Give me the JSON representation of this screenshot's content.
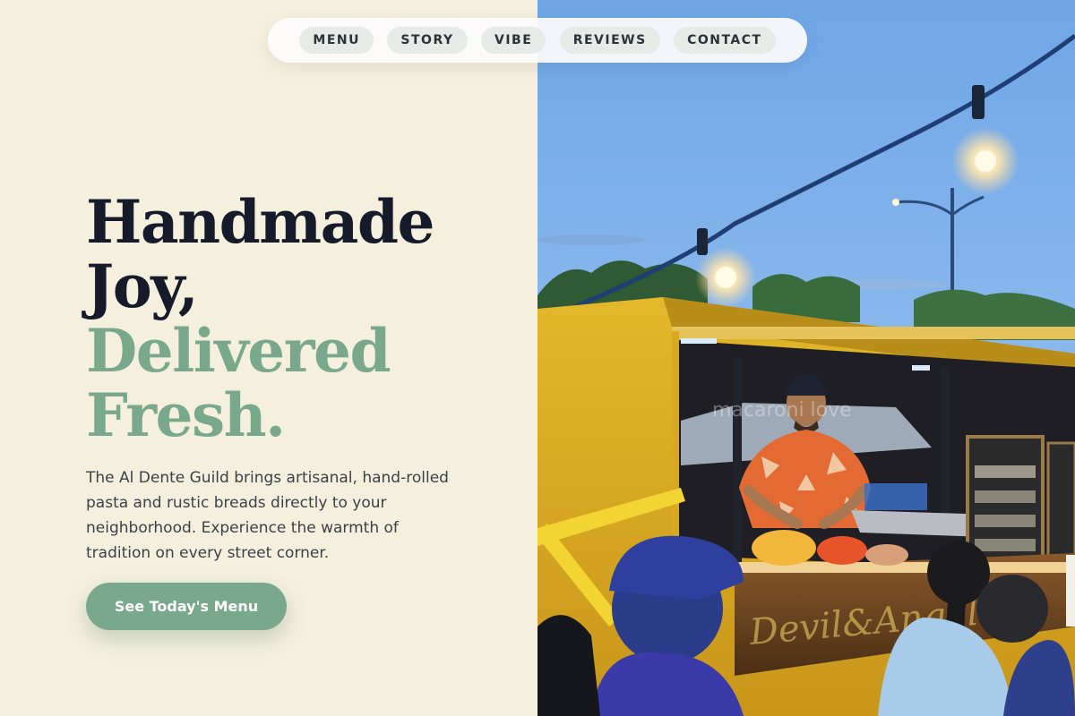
{
  "nav": {
    "items": [
      {
        "label": "MENU"
      },
      {
        "label": "STORY"
      },
      {
        "label": "VIBE"
      },
      {
        "label": "REVIEWS"
      },
      {
        "label": "CONTACT"
      }
    ]
  },
  "hero": {
    "headline_line1": "Handmade",
    "headline_line2": "Joy,",
    "headline_line3": "Delivered",
    "headline_line4": "Fresh.",
    "description": "The Al Dente Guild brings artisanal, hand-rolled pasta and rustic breads directly to your neighborhood. Experience the warmth of tradition on every street corner.",
    "cta_label": "See Today's Menu"
  },
  "photo": {
    "watermark": "macaroni love",
    "sign_text": "Devil&Angel"
  },
  "colors": {
    "background": "#f5f0de",
    "headline_dark": "#151b2b",
    "accent_green": "#7aa88c",
    "body_text": "#3b4149"
  }
}
